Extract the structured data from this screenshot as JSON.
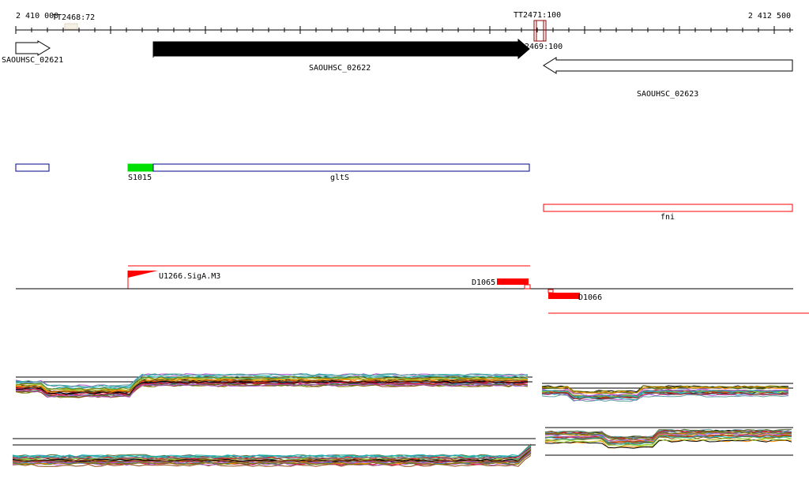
{
  "ruler": {
    "start_label": "2 410 000",
    "end_label": "2 412 500"
  },
  "probes": {
    "tt2468": "TT2468:72",
    "tt2471": "TT2471:100",
    "tt2469": "2469:100"
  },
  "genes": {
    "g02621": "SAOUHSC_02621",
    "g02622": "SAOUHSC_02622",
    "g02623": "SAOUHSC_02623"
  },
  "annotations": {
    "s1015": "S1015",
    "glts": "gltS",
    "fni": "fni"
  },
  "regulation": {
    "u1266": "U1266.SigA.M3",
    "d1065": "D1065",
    "d1066": "D1066"
  },
  "colors": {
    "gene_fill_dark": "#000000",
    "gene_outline": "#000000",
    "annotation_blue": "#00008b",
    "annotation_green": "#00e000",
    "annotation_red": "#ff0000",
    "probe_red": "#8b0000",
    "expression_palette": [
      "#000000",
      "#8b4513",
      "#556b2f",
      "#9acd32",
      "#ff8c00",
      "#b22222",
      "#4682b4",
      "#ba55d3",
      "#20b2aa",
      "#808000",
      "#dc143c",
      "#5f9ea0"
    ]
  }
}
